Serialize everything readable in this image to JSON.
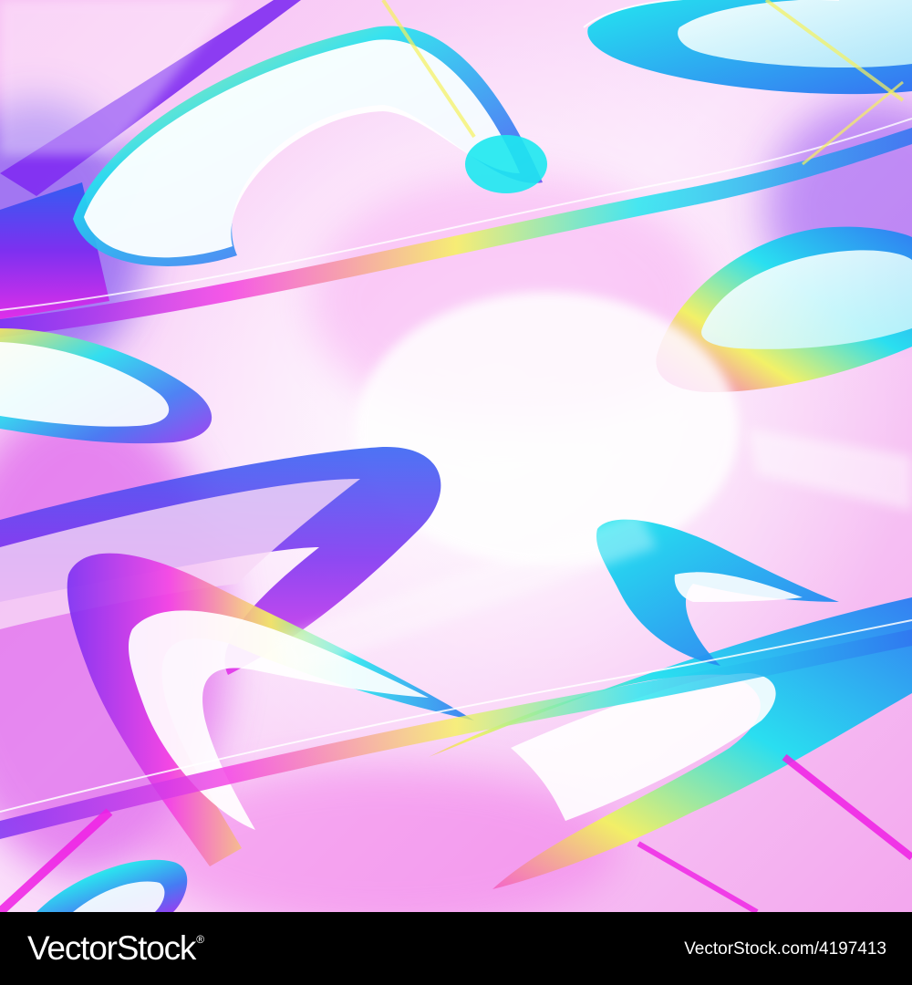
{
  "image": {
    "description_colors": {
      "magenta": "#f51fe6",
      "pink": "#f6a6ef",
      "violet": "#8a2cf0",
      "cyan": "#19e6f0",
      "blue": "#2a7cf2",
      "yellow": "#f7f25a",
      "white": "#ffffff"
    }
  },
  "footer": {
    "brand": "VectorStock",
    "registered_mark": "®",
    "stock_id": "VectorStock.com/4197413",
    "background": "#000000",
    "text_color": "#ffffff"
  }
}
